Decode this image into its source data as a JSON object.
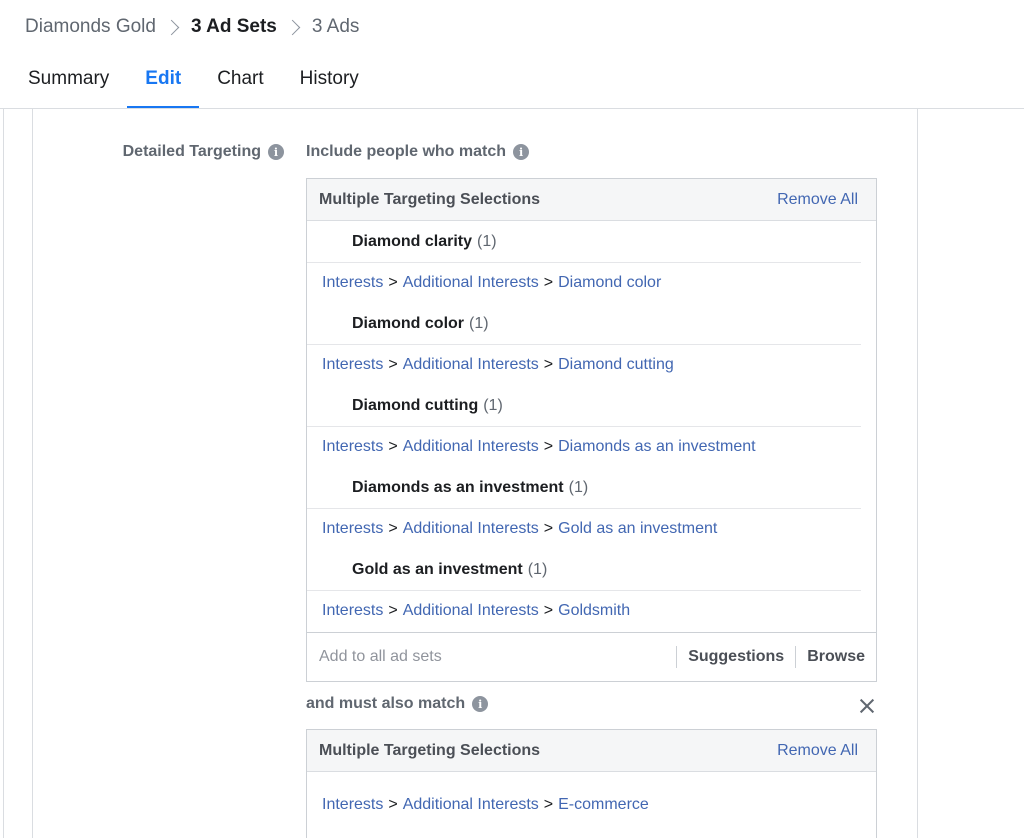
{
  "breadcrumb": {
    "campaign": "Diamonds Gold",
    "adsets": "3 Ad Sets",
    "ads": "3 Ads"
  },
  "tabs": [
    "Summary",
    "Edit",
    "Chart",
    "History"
  ],
  "active_tab": "Edit",
  "targeting": {
    "section_label": "Detailed Targeting",
    "include_label": "Include people who match",
    "box1": {
      "title": "Multiple Targeting Selections",
      "remove_all": "Remove All",
      "rows": [
        {
          "kind": "title",
          "name": "Diamond clarity",
          "count": "(1)"
        },
        {
          "kind": "path",
          "parts": [
            "Interests",
            "Additional Interests",
            "Diamond color"
          ]
        },
        {
          "kind": "title",
          "name": "Diamond color",
          "count": "(1)"
        },
        {
          "kind": "path",
          "parts": [
            "Interests",
            "Additional Interests",
            "Diamond cutting"
          ]
        },
        {
          "kind": "title",
          "name": "Diamond cutting",
          "count": "(1)"
        },
        {
          "kind": "path",
          "parts": [
            "Interests",
            "Additional Interests",
            "Diamonds as an investment"
          ]
        },
        {
          "kind": "title",
          "name": "Diamonds as an investment",
          "count": "(1)"
        },
        {
          "kind": "path",
          "parts": [
            "Interests",
            "Additional Interests",
            "Gold as an investment"
          ]
        },
        {
          "kind": "title",
          "name": "Gold as an investment",
          "count": "(1)"
        },
        {
          "kind": "path",
          "parts": [
            "Interests",
            "Additional Interests",
            "Goldsmith"
          ]
        }
      ],
      "add_placeholder": "Add to all ad sets",
      "suggestions": "Suggestions",
      "browse": "Browse"
    },
    "also_label": "and must also match",
    "box2": {
      "title": "Multiple Targeting Selections",
      "remove_all": "Remove All",
      "rows": [
        {
          "kind": "path",
          "parts": [
            "Interests",
            "Additional Interests",
            "E-commerce"
          ]
        }
      ]
    }
  },
  "colors": {
    "accent": "#1877f2",
    "link": "#4267b2",
    "muted": "#606770",
    "border": "#ccd0d5"
  }
}
